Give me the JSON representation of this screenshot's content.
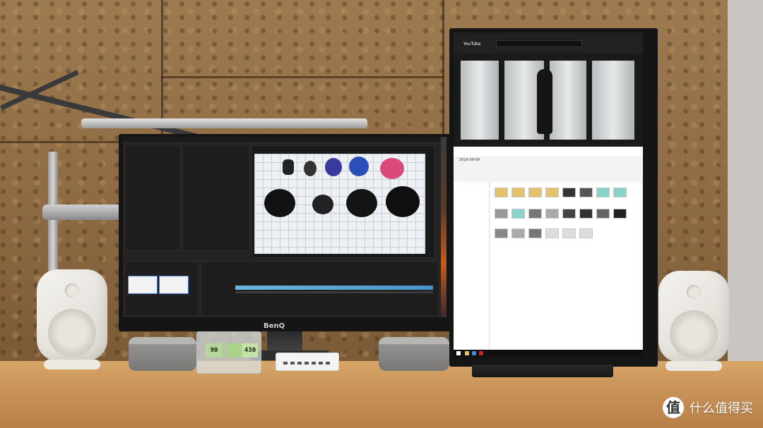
{
  "scene": {
    "left_monitor_brand": "BenQ",
    "right_monitor_app": "YouTube",
    "explorer_path": "2016-09-09",
    "meter_reading_left": "90",
    "meter_reading_right": "430"
  },
  "watermark": {
    "symbol": "值",
    "text": "什么值得买"
  },
  "colors": {
    "wall": "#8e6b43",
    "desk": "#c9935a",
    "accent_blue": "#4c7cc8"
  }
}
